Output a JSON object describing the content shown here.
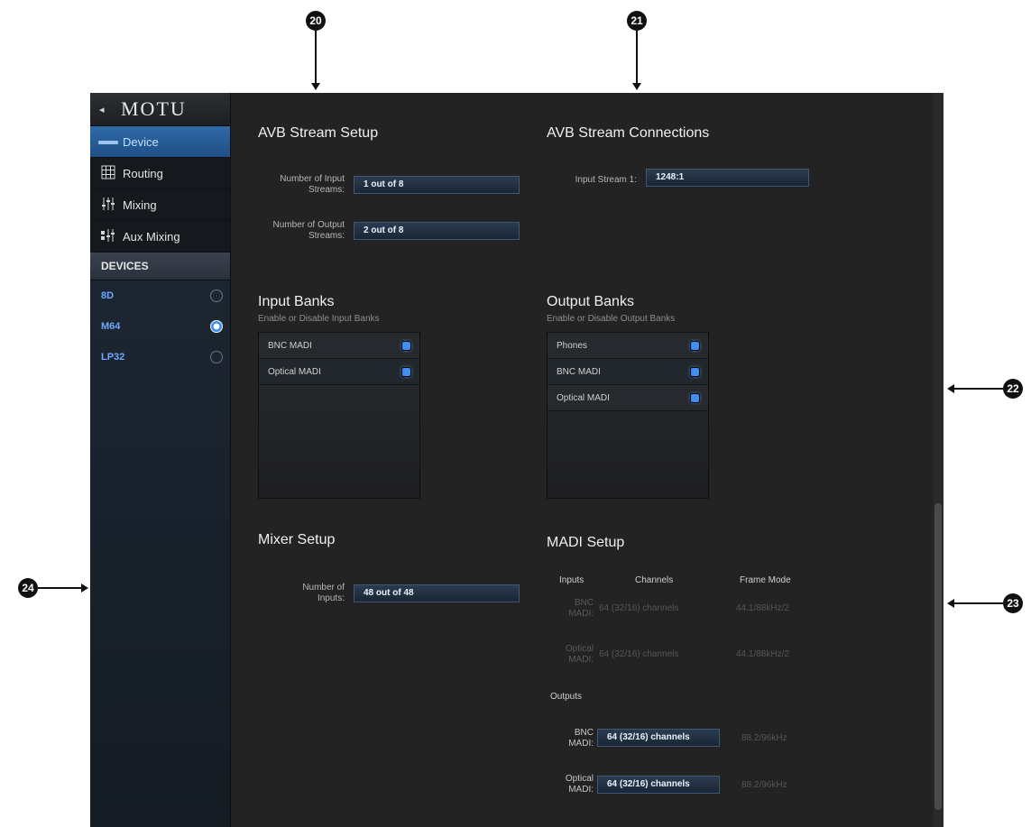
{
  "callouts": {
    "c20": "20",
    "c21": "21",
    "c22": "22",
    "c23": "23",
    "c24": "24"
  },
  "sidebar": {
    "back_glyph": "◂",
    "logo": "MOTU",
    "nav": [
      {
        "label": "Device",
        "icon": "device-icon",
        "active": true
      },
      {
        "label": "Routing",
        "icon": "grid-icon"
      },
      {
        "label": "Mixing",
        "icon": "faders-icon"
      },
      {
        "label": "Aux Mixing",
        "icon": "aux-faders-icon"
      }
    ],
    "devices_header": "DEVICES",
    "devices": [
      {
        "name": "8D",
        "selected": false
      },
      {
        "name": "M64",
        "selected": true
      },
      {
        "name": "LP32",
        "selected": false
      }
    ]
  },
  "avb_setup": {
    "title": "AVB Stream Setup",
    "input_label": "Number of Input Streams:",
    "input_value": "1 out of 8",
    "output_label": "Number of Output Streams:",
    "output_value": "2 out of 8"
  },
  "avb_connections": {
    "title": "AVB Stream Connections",
    "stream_label": "Input Stream 1:",
    "stream_value": "1248:1"
  },
  "input_banks": {
    "title": "Input Banks",
    "subtitle": "Enable or Disable Input Banks",
    "items": [
      {
        "label": "BNC MADI",
        "checked": true
      },
      {
        "label": "Optical MADI",
        "checked": true
      }
    ]
  },
  "output_banks": {
    "title": "Output Banks",
    "subtitle": "Enable or Disable Output Banks",
    "items": [
      {
        "label": "Phones",
        "checked": true
      },
      {
        "label": "BNC MADI",
        "checked": true
      },
      {
        "label": "Optical MADI",
        "checked": true
      }
    ]
  },
  "mixer_setup": {
    "title": "Mixer Setup",
    "inputs_label": "Number of Inputs:",
    "inputs_value": "48 out of 48"
  },
  "madi_setup": {
    "title": "MADI Setup",
    "col_inputs": "Inputs",
    "col_channels": "Channels",
    "col_frame": "Frame Mode",
    "inputs": [
      {
        "label": "BNC MADI:",
        "channels": "64 (32/16) channels",
        "frame": "44.1/88kHz/2"
      },
      {
        "label": "Optical MADI:",
        "channels": "64 (32/16) channels",
        "frame": "44.1/88kHz/2"
      }
    ],
    "outputs_header": "Outputs",
    "outputs": [
      {
        "label": "BNC MADI:",
        "channels": "64 (32/16) channels",
        "frame": "88.2/96kHz"
      },
      {
        "label": "Optical MADI:",
        "channels": "64 (32/16) channels",
        "frame": "88.2/96kHz"
      }
    ]
  },
  "colors": {
    "accent": "#2f6aa8",
    "checkbox": "#3f8ff3",
    "device_text": "#6ea9ff",
    "background": "#232323"
  }
}
